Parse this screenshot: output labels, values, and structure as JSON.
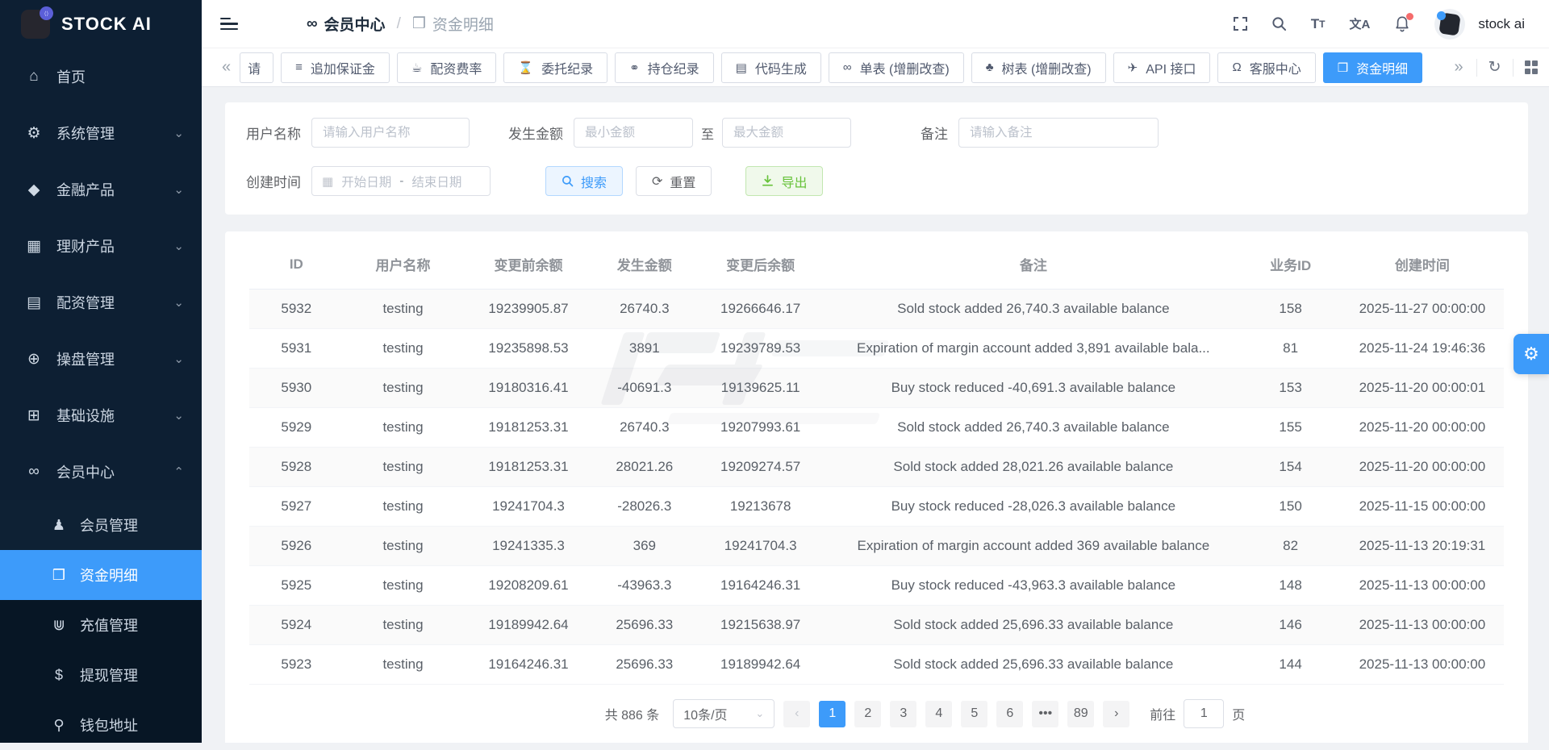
{
  "brand": {
    "name": "STOCK AI",
    "badge_glyph": "⟨⟩"
  },
  "breadcrumb": {
    "section_icon": "∞",
    "section": "会员中心",
    "separator": "/",
    "current_icon": "❒",
    "current": "资金明细"
  },
  "topbar": {
    "username": "stock ai",
    "translate_glyph": "文A",
    "font_glyph_big": "T",
    "font_glyph_small": "T"
  },
  "sidebar": {
    "items": [
      {
        "label": "首页",
        "icon": "⌂",
        "icon_name": "home-icon",
        "chevron": ""
      },
      {
        "label": "系统管理",
        "icon": "⚙",
        "icon_name": "gear-icon",
        "chevron": "⌄"
      },
      {
        "label": "金融产品",
        "icon": "◆",
        "icon_name": "gem-icon",
        "chevron": "⌄"
      },
      {
        "label": "理财产品",
        "icon": "▦",
        "icon_name": "package-icon",
        "chevron": "⌄"
      },
      {
        "label": "配资管理",
        "icon": "▤",
        "icon_name": "money-card-icon",
        "chevron": "⌄"
      },
      {
        "label": "操盘管理",
        "icon": "⊕",
        "icon_name": "globe-icon",
        "chevron": "⌄"
      },
      {
        "label": "基础设施",
        "icon": "⊞",
        "icon_name": "gift-icon",
        "chevron": "⌄"
      },
      {
        "label": "会员中心",
        "icon": "∞",
        "icon_name": "bicycle-icon",
        "chevron": "⌃",
        "expanded": true
      }
    ],
    "subitems": [
      {
        "label": "会员管理",
        "icon": "♟",
        "icon_name": "person-icon",
        "hovered": true
      },
      {
        "label": "资金明细",
        "icon": "❒",
        "icon_name": "book-icon",
        "active": true
      },
      {
        "label": "充值管理",
        "icon": "⋓",
        "icon_name": "cart-icon"
      },
      {
        "label": "提现管理",
        "icon": "$",
        "icon_name": "dollar-icon"
      },
      {
        "label": "钱包地址",
        "icon": "⚲",
        "icon_name": "pin-icon"
      }
    ]
  },
  "tabs": [
    {
      "label": "请",
      "icon": "",
      "icon_name": "",
      "partial": true
    },
    {
      "label": "追加保证金",
      "icon": "≡",
      "icon_name": "list-icon"
    },
    {
      "label": "配资费率",
      "icon": "☕",
      "icon_name": "coffee-icon"
    },
    {
      "label": "委托纪录",
      "icon": "⌛",
      "icon_name": "hourglass-icon"
    },
    {
      "label": "持仓纪录",
      "icon": "⚭",
      "icon_name": "binoculars-icon"
    },
    {
      "label": "代码生成",
      "icon": "▤",
      "icon_name": "document-icon"
    },
    {
      "label": "单表 (增删改查)",
      "icon": "∞",
      "icon_name": "bicycle-icon"
    },
    {
      "label": "树表 (增删改查)",
      "icon": "♣",
      "icon_name": "tree-icon"
    },
    {
      "label": "API 接口",
      "icon": "✈",
      "icon_name": "plane-icon"
    },
    {
      "label": "客服中心",
      "icon": "Ω",
      "icon_name": "headset-icon"
    },
    {
      "label": "资金明细",
      "icon": "❒",
      "icon_name": "book-icon",
      "active": true
    }
  ],
  "form": {
    "user_label": "用户名称",
    "user_placeholder": "请输入用户名称",
    "amount_label": "发生金额",
    "amount_min_placeholder": "最小金额",
    "amount_to": "至",
    "amount_max_placeholder": "最大金额",
    "note_label": "备注",
    "note_placeholder": "请输入备注",
    "date_label": "创建时间",
    "date_start": "开始日期",
    "date_sep": "-",
    "date_end": "结束日期",
    "calendar_glyph": "▦",
    "search_label": "搜索",
    "reset_label": "重置",
    "reset_glyph": "⟳",
    "export_label": "导出"
  },
  "table": {
    "headers": [
      "ID",
      "用户名称",
      "变更前余额",
      "发生金额",
      "变更后余额",
      "备注",
      "业务ID",
      "创建时间"
    ],
    "rows": [
      {
        "id": "5932",
        "user": "testing",
        "before": "19239905.87",
        "amount": "26740.3",
        "after": "19266646.17",
        "remark": "Sold stock added 26,740.3 available balance",
        "biz": "158",
        "created": "2025-11-27 00:00:00"
      },
      {
        "id": "5931",
        "user": "testing",
        "before": "19235898.53",
        "amount": "3891",
        "after": "19239789.53",
        "remark": "Expiration of margin account added 3,891 available bala...",
        "biz": "81",
        "created": "2025-11-24 19:46:36"
      },
      {
        "id": "5930",
        "user": "testing",
        "before": "19180316.41",
        "amount": "-40691.3",
        "after": "19139625.11",
        "remark": "Buy stock reduced -40,691.3 available balance",
        "biz": "153",
        "created": "2025-11-20 00:00:01"
      },
      {
        "id": "5929",
        "user": "testing",
        "before": "19181253.31",
        "amount": "26740.3",
        "after": "19207993.61",
        "remark": "Sold stock added 26,740.3 available balance",
        "biz": "155",
        "created": "2025-11-20 00:00:00"
      },
      {
        "id": "5928",
        "user": "testing",
        "before": "19181253.31",
        "amount": "28021.26",
        "after": "19209274.57",
        "remark": "Sold stock added 28,021.26 available balance",
        "biz": "154",
        "created": "2025-11-20 00:00:00"
      },
      {
        "id": "5927",
        "user": "testing",
        "before": "19241704.3",
        "amount": "-28026.3",
        "after": "19213678",
        "remark": "Buy stock reduced -28,026.3 available balance",
        "biz": "150",
        "created": "2025-11-15 00:00:00"
      },
      {
        "id": "5926",
        "user": "testing",
        "before": "19241335.3",
        "amount": "369",
        "after": "19241704.3",
        "remark": "Expiration of margin account added 369 available balance",
        "biz": "82",
        "created": "2025-11-13 20:19:31"
      },
      {
        "id": "5925",
        "user": "testing",
        "before": "19208209.61",
        "amount": "-43963.3",
        "after": "19164246.31",
        "remark": "Buy stock reduced -43,963.3 available balance",
        "biz": "148",
        "created": "2025-11-13 00:00:00"
      },
      {
        "id": "5924",
        "user": "testing",
        "before": "19189942.64",
        "amount": "25696.33",
        "after": "19215638.97",
        "remark": "Sold stock added 25,696.33 available balance",
        "biz": "146",
        "created": "2025-11-13 00:00:00"
      },
      {
        "id": "5923",
        "user": "testing",
        "before": "19164246.31",
        "amount": "25696.33",
        "after": "19189942.64",
        "remark": "Sold stock added 25,696.33 available balance",
        "biz": "144",
        "created": "2025-11-13 00:00:00"
      }
    ]
  },
  "pagination": {
    "total": "共 886 条",
    "page_size": "10条/页",
    "pages": [
      {
        "label": "1",
        "active": true
      },
      {
        "label": "2"
      },
      {
        "label": "3"
      },
      {
        "label": "4"
      },
      {
        "label": "5"
      },
      {
        "label": "6"
      },
      {
        "label": "•••"
      },
      {
        "label": "89"
      }
    ],
    "goto_label": "前往",
    "goto_value": "1",
    "goto_unit": "页"
  },
  "colors": {
    "accent": "#3d9bfa",
    "sidebar_bg": "#0d1f33",
    "success": "#67c23a",
    "danger": "#f56c6c"
  }
}
